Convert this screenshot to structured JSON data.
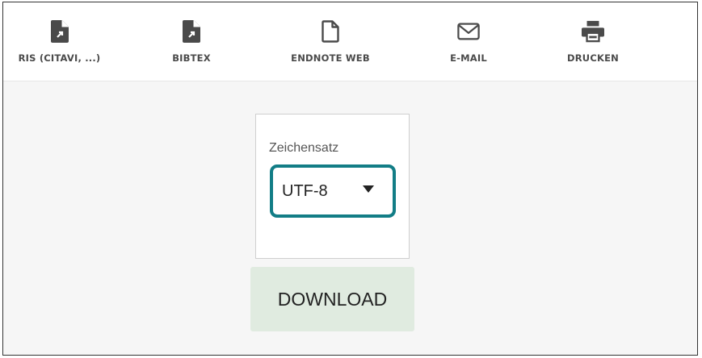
{
  "toolbar": {
    "items": [
      {
        "label": "RIS (CITAVI, ...)",
        "icon": "file-export-icon"
      },
      {
        "label": "BIBTEX",
        "icon": "file-export-icon"
      },
      {
        "label": "ENDNOTE WEB",
        "icon": "file-outline-icon"
      },
      {
        "label": "E-MAIL",
        "icon": "envelope-icon"
      },
      {
        "label": "DRUCKEN",
        "icon": "printer-icon"
      }
    ]
  },
  "export_panel": {
    "charset_label": "Zeichensatz",
    "charset_value": "UTF-8",
    "download_label": "DOWNLOAD"
  },
  "colors": {
    "highlight": "#127d86",
    "download_bg": "#e0ebe0",
    "toolbar_text": "#4a4a4a"
  }
}
